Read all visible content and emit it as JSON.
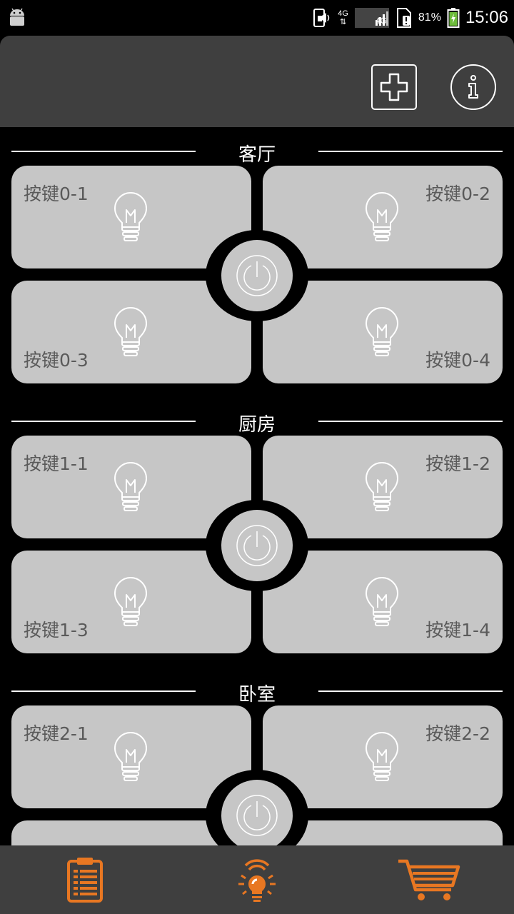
{
  "status_bar": {
    "network_top": "4G",
    "network_bottom": "4G",
    "battery_percent": "81%",
    "time": "15:06",
    "icons": [
      "android-icon",
      "phone-vibrate-icon",
      "signal-icon",
      "sim-alert-icon",
      "battery-icon"
    ]
  },
  "header": {
    "add_icon": "plus-icon",
    "info_icon": "info-icon"
  },
  "rooms": [
    {
      "name": "客厅",
      "buttons": [
        "按键0-1",
        "按键0-2",
        "按键0-3",
        "按键0-4"
      ]
    },
    {
      "name": "厨房",
      "buttons": [
        "按键1-1",
        "按键1-2",
        "按键1-3",
        "按键1-4"
      ]
    },
    {
      "name": "卧室",
      "buttons": [
        "按键2-1",
        "按键2-2",
        "",
        ""
      ]
    }
  ],
  "bottom_nav": {
    "items": [
      "clipboard-list-icon",
      "lightbulb-icon",
      "shopping-cart-icon"
    ],
    "accent_color": "#e87722"
  },
  "colors": {
    "background": "#000000",
    "panel": "#3f3f3f",
    "button": "#c6c6c6",
    "button_text": "#5a5a5a"
  }
}
